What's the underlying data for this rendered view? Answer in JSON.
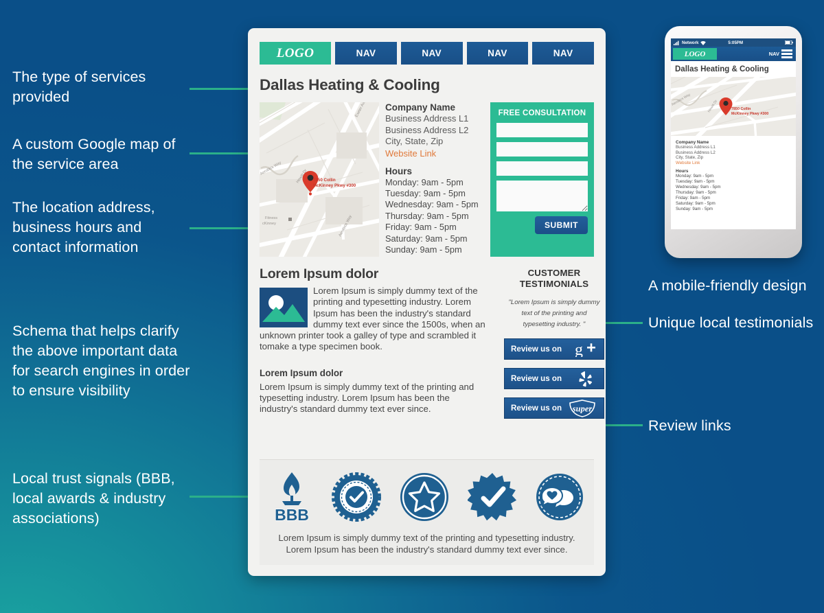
{
  "theme": {
    "bg_blue": "#0a4f88",
    "bg_teal": "#1aa3a0",
    "accent_green": "#2cbb94",
    "nav_blue": "#1d5b96",
    "link_orange": "#e0793a",
    "badge_blue": "#1f6091",
    "pin_red": "#d93b2b"
  },
  "annotations": {
    "left": [
      {
        "id": "services-type",
        "text": "The type of services provided"
      },
      {
        "id": "google-map",
        "text": "A custom Google map of the service area"
      },
      {
        "id": "location-hours",
        "text": "The location address, business hours and contact information"
      },
      {
        "id": "schema",
        "text": "Schema that helps clarify the above important data for search engines in order to ensure visibility"
      },
      {
        "id": "trust-signals",
        "text": "Local trust signals (BBB, local awards & industry associations)"
      }
    ],
    "right": [
      {
        "id": "mobile-friendly",
        "text": "A mobile-friendly design"
      },
      {
        "id": "testimonials",
        "text": "Unique local testimonials"
      },
      {
        "id": "review-links",
        "text": "Review links"
      }
    ]
  },
  "desktop": {
    "nav": {
      "logo": "LOGO",
      "items": [
        "NAV",
        "NAV",
        "NAV",
        "NAV"
      ]
    },
    "page_title": "Dallas Heating & Cooling",
    "map": {
      "pin_label_line1": "7850 Collin",
      "pin_label_line2": "McKinney Pkwy #300",
      "street_labels": [
        "Aerobics Way",
        "Hewitt Dr",
        "Exeter Ave",
        "Aerobics Way"
      ],
      "poi_label": "Fitness cKinney"
    },
    "business": {
      "company_name": "Company Name",
      "address_line1": "Business Address L1",
      "address_line2": "Business Address L2",
      "city_state_zip": "City, State, Zip",
      "website_link": "Website Link",
      "hours_title": "Hours",
      "hours": [
        "Monday: 9am - 5pm",
        "Tuesday: 9am - 5pm",
        "Wednesday: 9am - 5pm",
        "Thursday: 9am - 5pm",
        "Friday: 9am - 5pm",
        "Saturday: 9am - 5pm",
        "Sunday: 9am - 5pm"
      ]
    },
    "form": {
      "title": "FREE CONSULTATION",
      "field_placeholder": "",
      "submit_label": "SUBMIT"
    },
    "content": {
      "heading1": "Lorem Ipsum dolor",
      "body1": "Lorem Ipsum is simply dummy text of the printing and typesetting industry. Lorem Ipsum has been the industry's standard dummy text ever since the 1500s, when an unknown printer took a galley of type and scrambled it tomake a type specimen book.",
      "heading2": "Lorem Ipsum dolor",
      "body2": "Lorem Ipsum is simply dummy text of the printing and typesetting industry. Lorem Ipsum has been the industry's standard dummy text ever since."
    },
    "testimonials": {
      "title_line1": "CUSTOMER",
      "title_line2": "TESTIMONIALS",
      "quote": "\"Lorem Ipsum is simply dummy text of the printing and typesetting industry. \""
    },
    "reviews": [
      {
        "label": "Review us on",
        "icon": "google-plus-icon"
      },
      {
        "label": "Review us on",
        "icon": "yelp-icon"
      },
      {
        "label": "Review us on",
        "icon": "angies-list-super-service-icon"
      }
    ],
    "footer": {
      "badges": [
        "bbb-torch-icon",
        "certified-rosette-icon",
        "star-seal-icon",
        "checkmark-burst-icon",
        "heart-chat-seal-icon"
      ],
      "text": "Lorem Ipsum is simply dummy text of the printing and typesetting industry. Lorem Ipsum has been the industry's standard dummy text ever since."
    }
  },
  "phone": {
    "status": {
      "signal": "signal-bars-icon",
      "carrier": "Network",
      "wifi": "wifi-icon",
      "time": "5:05PM",
      "battery": "battery-icon"
    },
    "nav": {
      "logo": "LOGO",
      "label": "NAV",
      "menu_icon": "hamburger-menu-icon"
    },
    "page_title": "Dallas Heating & Cooling",
    "map": {
      "pin_label_line1": "7850 Collin",
      "pin_label_line2": "McKinney Pkwy #300"
    },
    "business": {
      "company_name": "Company Name",
      "address_line1": "Business Address L1",
      "address_line2": "Business Address L2",
      "city_state_zip": "City, State, Zip",
      "website_link": "Website Link",
      "hours_title": "Hours",
      "hours": [
        "Monday: 9am - 5pm",
        "Tuesday: 9am - 5pm",
        "Wednesday: 9am - 5pm",
        "Thursday: 9am - 5pm",
        "Friday: 9am - 5pm",
        "Saturday: 9am - 5pm",
        "Sunday: 9am - 5pm"
      ]
    }
  }
}
